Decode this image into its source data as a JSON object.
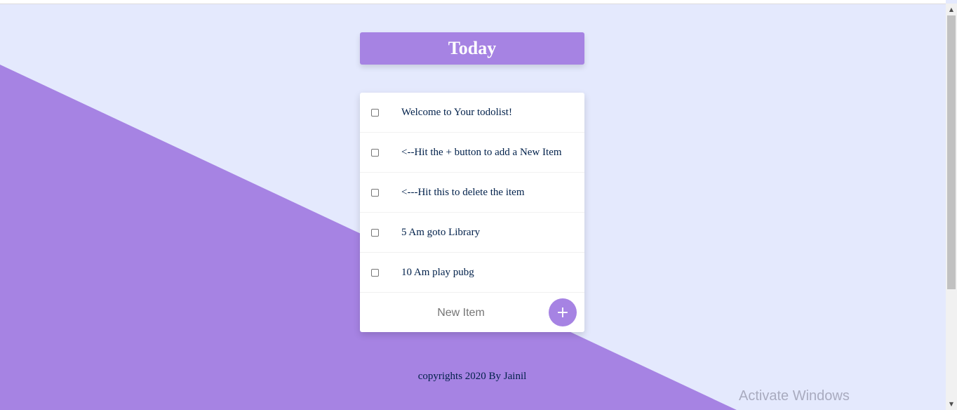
{
  "colors": {
    "background": "#e4e9fd",
    "accent": "#a683e3",
    "text": "#00204a",
    "card": "#ffffff"
  },
  "header": {
    "title": "Today"
  },
  "items": [
    {
      "label": "Welcome to Your todolist!",
      "checked": false
    },
    {
      "label": "<--Hit the + button to add a New Item",
      "checked": false
    },
    {
      "label": "<---Hit this to delete the item",
      "checked": false
    },
    {
      "label": "5 Am goto Library",
      "checked": false
    },
    {
      "label": "10 Am play pubg",
      "checked": false
    }
  ],
  "new_item": {
    "placeholder": "New Item",
    "value": "",
    "add_label": "+",
    "add_icon": "plus-icon"
  },
  "footer": {
    "text": "copyrights 2020 By Jainil"
  },
  "watermark": {
    "title": "Activate Windows"
  }
}
